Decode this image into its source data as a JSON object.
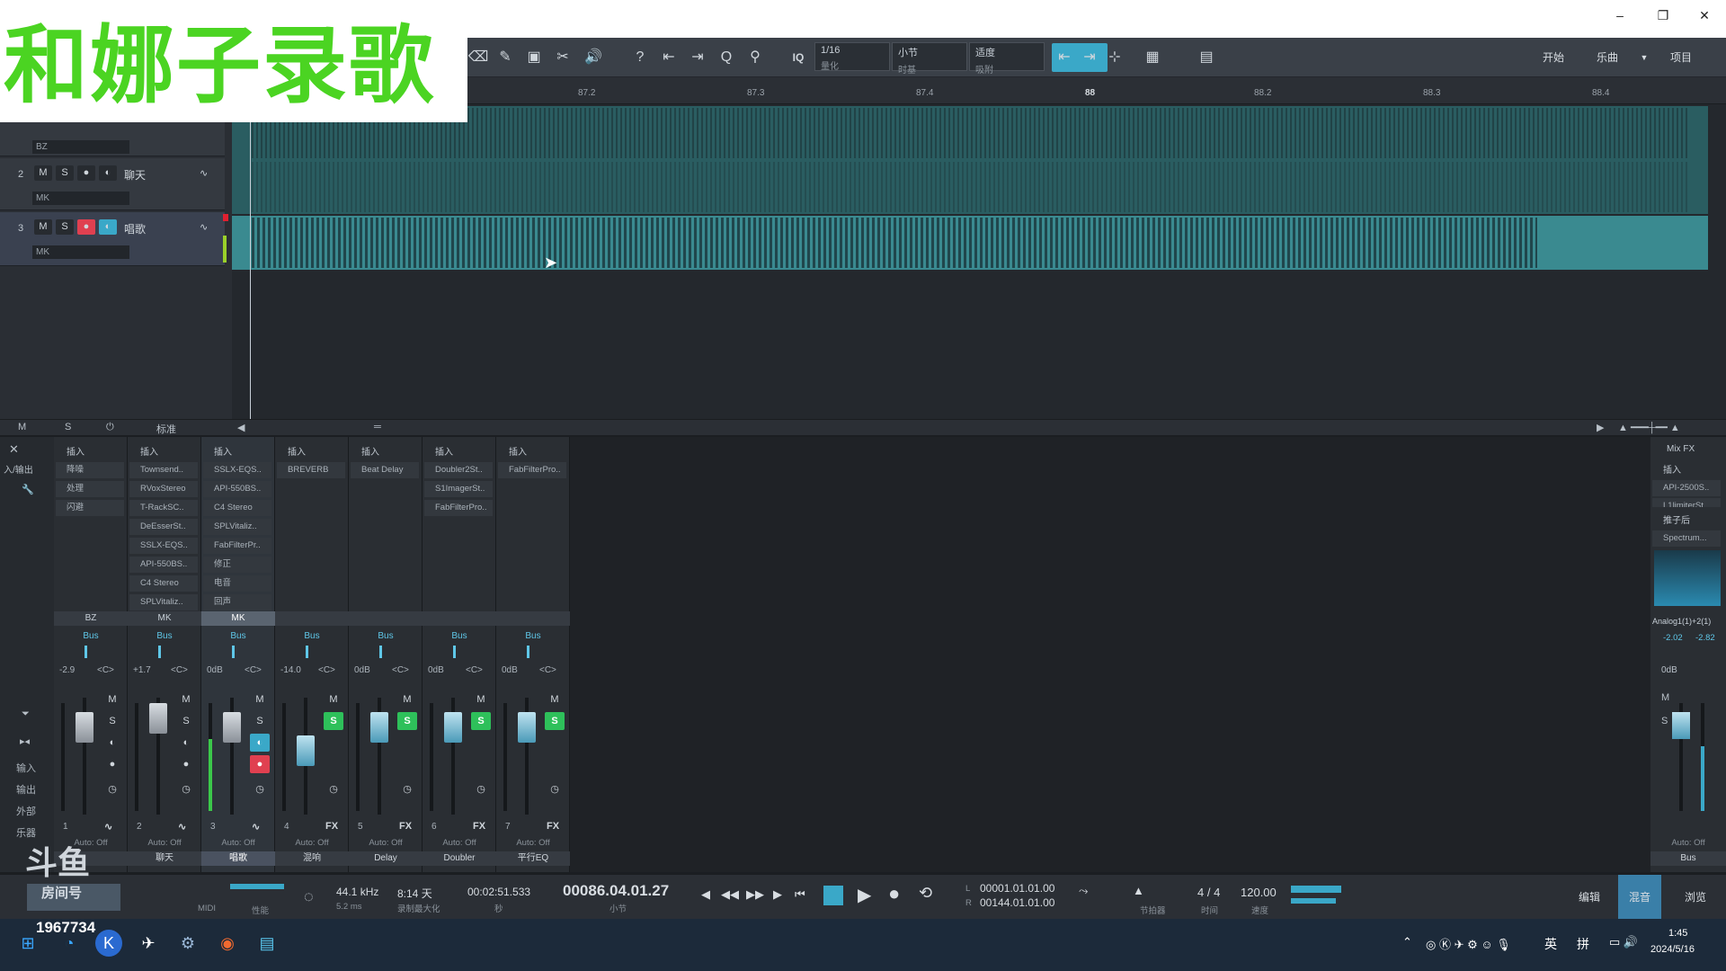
{
  "window": {
    "minimize": "–",
    "maximize": "❐",
    "close": "✕"
  },
  "banner": {
    "text": "和娜子录歌"
  },
  "toolbar": {
    "quantize_label": "IQ",
    "quantize_value": "1/16",
    "quantize_sub": "量化",
    "timebase_value": "小节",
    "timebase_sub": "时基",
    "snap_value": "适度",
    "snap_sub": "吸附",
    "start_label": "开始",
    "song_label": "乐曲",
    "project_label": "项目"
  },
  "ruler": {
    "ticks": [
      "87.2",
      "87.3",
      "87.4",
      "88",
      "88.2",
      "88.3",
      "88.4"
    ]
  },
  "tracks": [
    {
      "num": "",
      "name": "",
      "input": "BZ"
    },
    {
      "num": "2",
      "name": "聊天",
      "input": "MK"
    },
    {
      "num": "3",
      "name": "唱歌",
      "input": "MK"
    }
  ],
  "track_footer": {
    "m": "M",
    "s": "S",
    "mode": "标准"
  },
  "mixer": {
    "insert_label": "插入",
    "left_tools": [
      "输入",
      "输出",
      "外部",
      "乐器"
    ],
    "inout_label": "入/输出",
    "channels": [
      {
        "title": "BZ",
        "bus": "Bus",
        "vol": "-2.9",
        "pan": "<C>",
        "num": "1",
        "auto": "Auto: Off",
        "name": "",
        "plugins": [
          "降噪",
          "处理",
          "闪避"
        ]
      },
      {
        "title": "MK",
        "bus": "Bus",
        "vol": "+1.7",
        "pan": "<C>",
        "num": "2",
        "auto": "Auto: Off",
        "name": "聊天",
        "plugins": [
          "Townsend..",
          "RVoxStereo",
          "T-RackSC..",
          "DeEsserSt..",
          "SSLX-EQS..",
          "API-550BS..",
          "C4 Stereo",
          "SPLVitaliz.."
        ]
      },
      {
        "title": "MK",
        "bus": "Bus",
        "vol": "0dB",
        "pan": "<C>",
        "num": "3",
        "auto": "Auto: Off",
        "name": "唱歌",
        "plugins": [
          "SSLX-EQS..",
          "API-550BS..",
          "C4 Stereo",
          "SPLVitaliz..",
          "FabFilterPr..",
          "修正",
          "电音",
          "回声"
        ]
      },
      {
        "title": "",
        "bus": "Bus",
        "vol": "-14.0",
        "pan": "<C>",
        "num": "4",
        "auto": "Auto: Off",
        "name": "混响",
        "plugins": [
          "BREVERB"
        ],
        "fx": "FX"
      },
      {
        "title": "",
        "bus": "Bus",
        "vol": "0dB",
        "pan": "<C>",
        "num": "5",
        "auto": "Auto: Off",
        "name": "Delay",
        "plugins": [
          "Beat Delay"
        ],
        "fx": "FX"
      },
      {
        "title": "",
        "bus": "Bus",
        "vol": "0dB",
        "pan": "<C>",
        "num": "6",
        "auto": "Auto: Off",
        "name": "Doubler",
        "plugins": [
          "Doubler2St..",
          "S1ImagerSt..",
          "FabFilterPro.."
        ],
        "fx": "FX"
      },
      {
        "title": "",
        "bus": "Bus",
        "vol": "0dB",
        "pan": "<C>",
        "num": "7",
        "auto": "Auto: Off",
        "name": "平行EQ",
        "plugins": [
          "FabFilterPro.."
        ],
        "fx": "FX"
      }
    ],
    "master": {
      "mixfx": "Mix FX",
      "insert_label": "插入",
      "plugins": [
        "API-2500S..",
        "L1limiterSt.."
      ],
      "post_label": "推子后",
      "post_plugin": "Spectrum...",
      "io": "Analog1(1)+2(1)",
      "l_val": "-2.02",
      "r_val": "-2.82",
      "vol": "0dB",
      "auto": "Auto: Off",
      "name": "Bus"
    }
  },
  "transport": {
    "midi": "MIDI",
    "perf": "性能",
    "sample_rate": "44.1 kHz",
    "latency": "5.2 ms",
    "rec_time": "8:14 天",
    "rec_sub": "录制最大化",
    "seconds": "00:02:51.533",
    "seconds_sub": "秒",
    "bars": "00086.04.01.27",
    "bars_sub": "小节",
    "loop_l": "00001.01.01.00",
    "loop_r": "00144.01.01.00",
    "metronome": "节拍器",
    "timesig": "4 / 4",
    "timesig_sub": "时间",
    "tempo": "120.00",
    "tempo_sub": "速度",
    "edit": "编辑",
    "mix": "混音",
    "browse": "浏览"
  },
  "watermark": {
    "room_label": "房间号",
    "room_number": "1967734"
  },
  "tray": {
    "lang1": "英",
    "lang2": "拼",
    "time": "1:45",
    "date": "2024/5/16"
  },
  "colors": {
    "accent": "#3aa8c8",
    "solo": "#2ec05a",
    "record": "#e04050",
    "banner_text": "#4bd422"
  }
}
